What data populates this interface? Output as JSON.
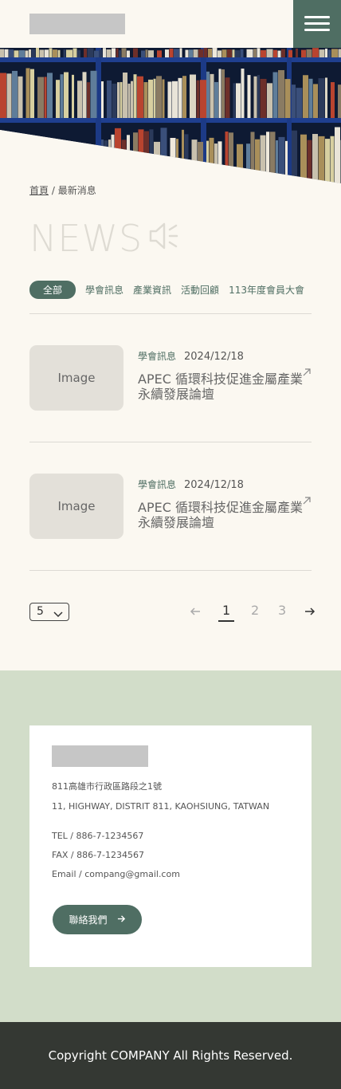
{
  "header": {
    "menu_icon": "hamburger-icon",
    "accent_color": "#4f6e63"
  },
  "breadcrumb": {
    "home": "首頁",
    "separator": " / ",
    "current": "最新消息"
  },
  "page": {
    "title": "NEWS",
    "title_icon": "speaker-icon"
  },
  "tabs": [
    {
      "label": "全部",
      "active": true
    },
    {
      "label": "學會訊息",
      "active": false
    },
    {
      "label": "產業資訊",
      "active": false
    },
    {
      "label": "活動回顧",
      "active": false
    },
    {
      "label": "113年度會員大會",
      "active": false
    }
  ],
  "news": [
    {
      "image_label": "Image",
      "category": "學會訊息",
      "date": "2024/12/18",
      "title": "APEC 循環科技促進金屬產業永續發展論壇"
    },
    {
      "image_label": "Image",
      "category": "學會訊息",
      "date": "2024/12/18",
      "title": "APEC 循環科技促進金屬產業永續發展論壇"
    }
  ],
  "pagination": {
    "per_page": "5",
    "pages": [
      "1",
      "2",
      "3"
    ],
    "current": "1"
  },
  "contact": {
    "address_zh": "811高雄市行政區路段之1號",
    "address_en": "11, HIGHWAY, DISTRIT 811, KAOHSIUNG, TATWAN",
    "tel": "TEL / 886-7-1234567",
    "fax": "FAX / 886-7-1234567",
    "email": "Email / compang@gmail.com",
    "button_label": "聯絡我們"
  },
  "footer": {
    "copyright": "Copyright COMPANY All Rights Reserved.",
    "background_color": "#343833"
  }
}
